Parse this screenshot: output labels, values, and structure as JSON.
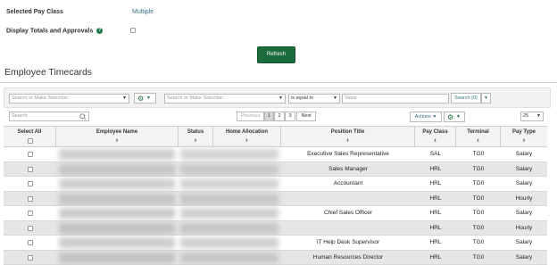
{
  "settings": {
    "pay_class_label": "Selected Pay Class",
    "pay_class_value": "Multiple",
    "display_totals_label": "Display Totals and Approvals",
    "help_glyph": "?",
    "refresh_label": "Refresh"
  },
  "section": {
    "title": "Employee Timecards"
  },
  "filter": {
    "search_placeholder": "Search or Make Selection",
    "field_placeholder": "Search or Make Selection",
    "operator_value": "is equal to",
    "value_placeholder": "Value",
    "search_button_label": "Search (0)"
  },
  "toolbar": {
    "search_placeholder": "Search",
    "pagination": {
      "previous": "Previous",
      "pages": [
        "1",
        "2",
        "3"
      ],
      "next": "Next"
    },
    "actions_label": "Actions",
    "page_size_value": "25"
  },
  "table": {
    "columns": [
      "Select All",
      "Employee Name",
      "Status",
      "Home Allocation",
      "Position Title",
      "Pay Class",
      "Terminal",
      "Pay Type"
    ],
    "sort_glyph": "⬍",
    "rows": [
      {
        "position": "Executive Sales Representative",
        "pay_class": "SAL",
        "terminal": "TG0",
        "pay_type": "Salary"
      },
      {
        "position": "Sales Manager",
        "pay_class": "HRL",
        "terminal": "TG0",
        "pay_type": "Salary"
      },
      {
        "position": "Accountant",
        "pay_class": "HRL",
        "terminal": "TG0",
        "pay_type": "Salary"
      },
      {
        "position": "",
        "pay_class": "HRL",
        "terminal": "TG0",
        "pay_type": "Hourly"
      },
      {
        "position": "Chief Sales Officer",
        "pay_class": "HRL",
        "terminal": "TG0",
        "pay_type": "Salary"
      },
      {
        "position": "",
        "pay_class": "HRL",
        "terminal": "TG0",
        "pay_type": "Hourly"
      },
      {
        "position": "IT Help Desk Supervisor",
        "pay_class": "HRL",
        "terminal": "TG0",
        "pay_type": "Salary"
      },
      {
        "position": "Human Resources Director",
        "pay_class": "HRL",
        "terminal": "TG0",
        "pay_type": "Salary"
      }
    ]
  },
  "colors": {
    "accent_green": "#1c6b3c",
    "link_teal": "#2f6f7a",
    "row_alt": "#e6e6e6"
  }
}
